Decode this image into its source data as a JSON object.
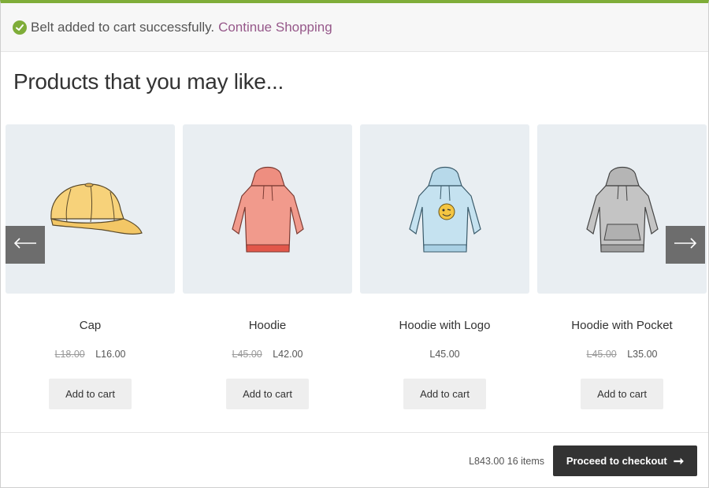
{
  "notice": {
    "message": "Belt added to cart successfully.",
    "link": "Continue Shopping",
    "icon": "check-circle-icon",
    "accent": "#7fad39"
  },
  "heading": "Products that you may like...",
  "products": [
    {
      "name": "Cap",
      "old_price": "L18.00",
      "price": "L16.00",
      "button": "Add to cart",
      "image": "cap-image"
    },
    {
      "name": "Hoodie",
      "old_price": "L45.00",
      "price": "L42.00",
      "button": "Add to cart",
      "image": "hoodie-image"
    },
    {
      "name": "Hoodie with Logo",
      "old_price": "",
      "price": "L45.00",
      "button": "Add to cart",
      "image": "hoodie-with-logo-image"
    },
    {
      "name": "Hoodie with Pocket",
      "old_price": "L45.00",
      "price": "L35.00",
      "button": "Add to cart",
      "image": "hoodie-with-pocket-image"
    }
  ],
  "carousel": {
    "prev_icon": "arrow-left-icon",
    "next_icon": "arrow-right-icon"
  },
  "footer": {
    "total": "L843.00 16 items",
    "checkout_label": "Proceed to checkout",
    "checkout_icon": "arrow-right-icon"
  }
}
